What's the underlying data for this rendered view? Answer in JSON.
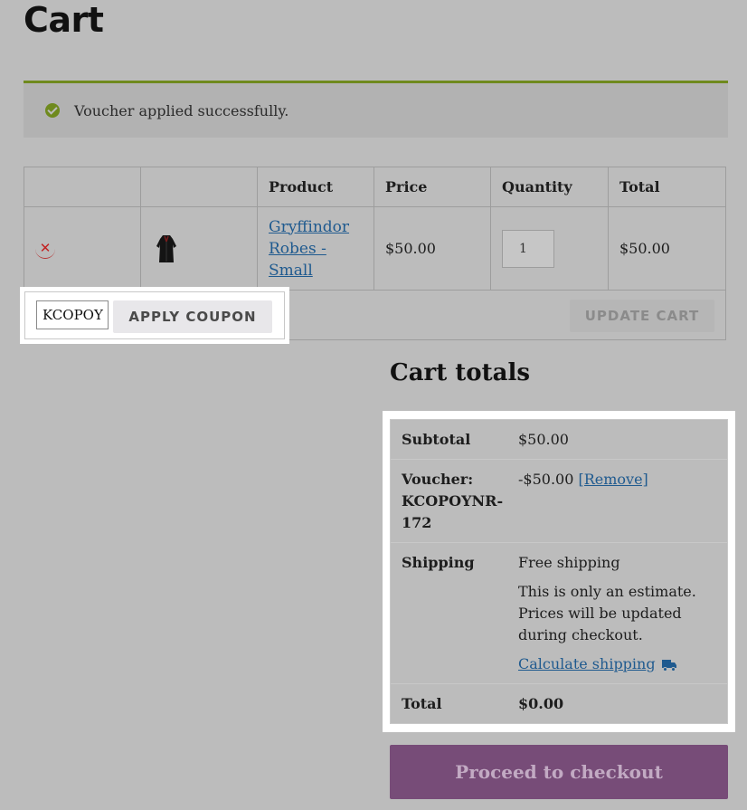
{
  "page": {
    "title": "Cart"
  },
  "notice": {
    "message": "Voucher applied successfully.",
    "icon": "check-circle-icon",
    "accent": "#6f8a1e"
  },
  "cart_table": {
    "headers": [
      "",
      "",
      "Product",
      "Price",
      "Quantity",
      "Total"
    ],
    "item": {
      "product_lines": [
        "Gryffindor",
        "Robes -",
        "Small"
      ],
      "price": "$50.00",
      "quantity": "1",
      "total": "$50.00"
    },
    "coupon_input_value": "KCOPOY",
    "apply_coupon_label": "APPLY COUPON",
    "update_cart_label": "UPDATE CART"
  },
  "cart_totals": {
    "title": "Cart totals",
    "subtotal_label": "Subtotal",
    "subtotal_value": "$50.00",
    "voucher_label_lines": [
      "Voucher:",
      "KCOPOYNR-",
      "172"
    ],
    "voucher_value": "-$50.00",
    "voucher_remove": "[Remove]",
    "shipping_label": "Shipping",
    "shipping_value": "Free shipping",
    "shipping_note_lines": [
      "This is only an estimate.",
      "Prices will be updated",
      "during checkout."
    ],
    "calculate_shipping": "Calculate shipping",
    "total_label": "Total",
    "total_value": "$0.00"
  },
  "checkout": {
    "label": "Proceed to checkout",
    "color": "#774c78"
  }
}
